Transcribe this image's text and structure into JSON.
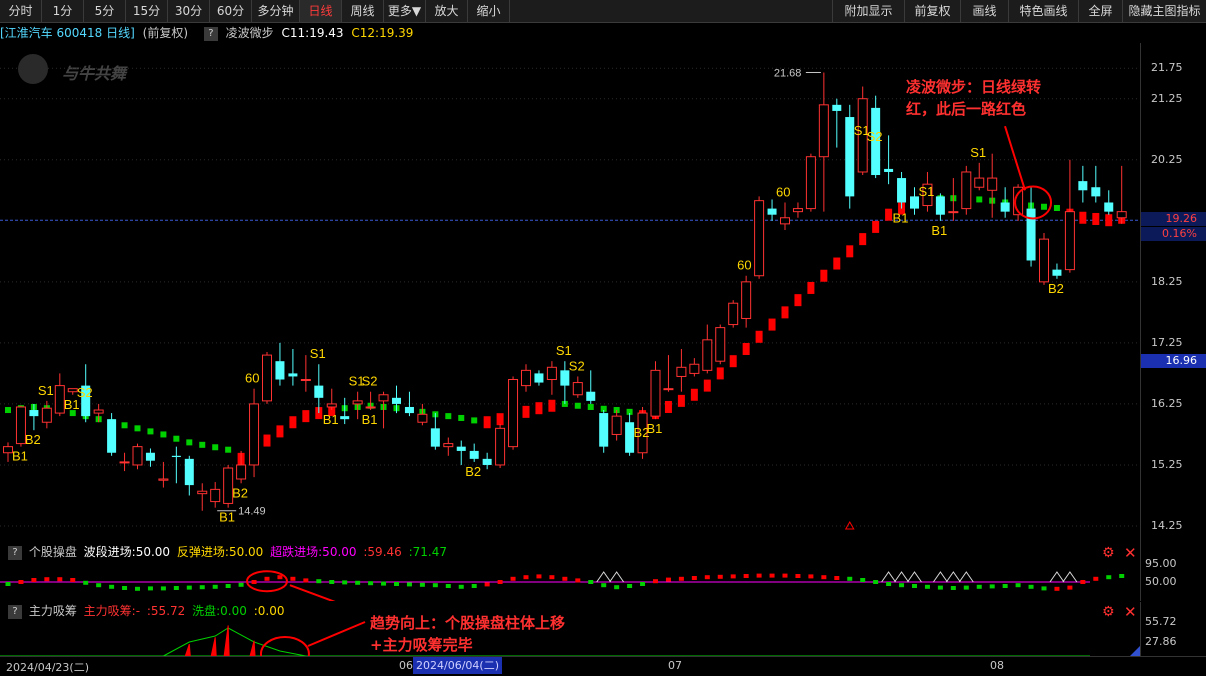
{
  "toolbar": {
    "left_buttons": [
      "分时",
      "1分",
      "5分",
      "15分",
      "30分",
      "60分",
      "多分钟",
      "日线",
      "周线",
      "更多▼",
      "放大",
      "缩小"
    ],
    "active": "日线",
    "right_buttons": [
      "附加显示",
      "前复权",
      "画线",
      "特色画线",
      "全屏",
      "隐藏主图指标"
    ]
  },
  "info": {
    "stock": "[江淮汽车 600418 日线]",
    "adjust": "(前复权)",
    "q": "?",
    "indicator": "凌波微步",
    "c11": "C11:19.43",
    "c12": "C12:19.39"
  },
  "watermark": "与牛共舞",
  "price_ticks": [
    "21.75",
    "21.25",
    "20.25",
    "19.26",
    "0.16%",
    "18.25",
    "17.25",
    "16.96",
    "16.25",
    "15.25",
    "14.25"
  ],
  "price_boxes": {
    "last": "19.26",
    "pct": "0.16%",
    "cursor": "16.96"
  },
  "annotations": {
    "top": "凌波微步：日线绿转红，此后一路红色",
    "bottom": "趋势向上：个股操盘柱体上移+主力吸筹完毕"
  },
  "labels": {
    "high": "21.68",
    "low": "14.49"
  },
  "panel1": {
    "q": "?",
    "name": "个股操盘",
    "wave": "波段进场:50.00",
    "rebound": "反弹进场:50.00",
    "oversold": "超跌进场:50.00",
    "v1": ":59.46",
    "v2": ":71.47",
    "ticks": [
      "95.00",
      "50.00"
    ]
  },
  "panel2": {
    "q": "?",
    "name": "主力吸筹",
    "main": "主力吸筹:-",
    "main_v": ":55.72",
    "wash": "洗盘:0.00",
    "v": ":0.00",
    "ticks": [
      "55.72",
      "27.86"
    ]
  },
  "gear_icon": "⚙",
  "close_icon": "✕",
  "dates": {
    "start": "2024/04/23(二)",
    "m06": "06",
    "highlight": "2024/06/04(二)",
    "m07": "07",
    "m08": "08"
  },
  "colors": {
    "up": "#ff3232",
    "down": "#54ffff",
    "green": "#00d000",
    "red": "#ff0000",
    "yellow": "#ffd700",
    "magenta": "#ff00ff"
  },
  "chart_data": {
    "type": "candlestick",
    "yrange": [
      14.25,
      21.95
    ],
    "candles": [
      [
        15.45,
        15.62,
        15.3,
        15.55
      ],
      [
        15.6,
        16.22,
        15.55,
        16.2
      ],
      [
        16.15,
        16.25,
        15.82,
        16.05
      ],
      [
        15.95,
        16.3,
        15.85,
        16.18
      ],
      [
        16.1,
        16.75,
        16.05,
        16.55
      ],
      [
        16.45,
        16.5,
        16.4,
        16.5
      ],
      [
        16.55,
        16.9,
        15.95,
        16.05
      ],
      [
        16.1,
        16.25,
        15.95,
        16.15
      ],
      [
        16.0,
        16.1,
        15.4,
        15.45
      ],
      [
        15.3,
        15.45,
        15.15,
        15.3
      ],
      [
        15.25,
        15.6,
        15.18,
        15.55
      ],
      [
        15.45,
        15.52,
        15.22,
        15.32
      ],
      [
        15.0,
        15.3,
        14.88,
        15.02
      ],
      [
        15.4,
        15.55,
        14.95,
        15.38
      ],
      [
        15.35,
        15.4,
        14.75,
        14.92
      ],
      [
        14.78,
        14.95,
        14.5,
        14.82
      ],
      [
        14.65,
        14.97,
        14.55,
        14.85
      ],
      [
        14.62,
        15.25,
        14.55,
        15.2
      ],
      [
        15.02,
        15.48,
        14.95,
        15.25
      ],
      [
        15.25,
        16.5,
        15.05,
        16.25
      ],
      [
        16.3,
        17.1,
        16.25,
        17.05
      ],
      [
        16.95,
        17.25,
        16.55,
        16.65
      ],
      [
        16.75,
        17.15,
        16.55,
        16.7
      ],
      [
        16.65,
        17.05,
        16.45,
        16.65
      ],
      [
        16.55,
        16.9,
        16.1,
        16.35
      ],
      [
        16.2,
        16.5,
        16.15,
        16.25
      ],
      [
        16.05,
        16.35,
        15.92,
        16.0
      ],
      [
        16.25,
        16.45,
        16.0,
        16.3
      ],
      [
        16.2,
        16.45,
        16.15,
        16.2
      ],
      [
        16.3,
        16.45,
        15.85,
        16.4
      ],
      [
        16.35,
        16.55,
        16.1,
        16.25
      ],
      [
        16.2,
        16.45,
        16.05,
        16.1
      ],
      [
        15.95,
        16.25,
        15.9,
        16.08
      ],
      [
        15.85,
        16.1,
        15.5,
        15.55
      ],
      [
        15.55,
        15.7,
        15.4,
        15.6
      ],
      [
        15.55,
        15.65,
        15.25,
        15.48
      ],
      [
        15.48,
        15.6,
        15.3,
        15.35
      ],
      [
        15.35,
        15.45,
        15.18,
        15.25
      ],
      [
        15.25,
        15.92,
        15.2,
        15.85
      ],
      [
        15.55,
        16.7,
        15.5,
        16.65
      ],
      [
        16.55,
        16.9,
        16.45,
        16.8
      ],
      [
        16.75,
        16.8,
        16.55,
        16.6
      ],
      [
        16.65,
        16.95,
        16.4,
        16.85
      ],
      [
        16.8,
        16.95,
        16.25,
        16.55
      ],
      [
        16.4,
        16.7,
        16.35,
        16.6
      ],
      [
        16.45,
        16.8,
        16.25,
        16.3
      ],
      [
        16.1,
        16.15,
        15.45,
        15.55
      ],
      [
        15.75,
        16.15,
        15.65,
        16.05
      ],
      [
        15.95,
        16.1,
        15.4,
        15.45
      ],
      [
        15.45,
        16.2,
        15.35,
        16.1
      ],
      [
        16.05,
        16.95,
        16.0,
        16.8
      ],
      [
        16.5,
        17.05,
        16.45,
        16.5
      ],
      [
        16.7,
        17.15,
        16.45,
        16.85
      ],
      [
        16.75,
        17.0,
        16.7,
        16.9
      ],
      [
        16.8,
        17.55,
        16.75,
        17.3
      ],
      [
        16.95,
        17.55,
        16.9,
        17.5
      ],
      [
        17.55,
        17.95,
        17.5,
        17.9
      ],
      [
        17.65,
        18.35,
        17.5,
        18.25
      ],
      [
        18.35,
        19.65,
        18.3,
        19.58
      ],
      [
        19.45,
        19.6,
        19.25,
        19.35
      ],
      [
        19.2,
        19.55,
        19.1,
        19.3
      ],
      [
        19.4,
        19.55,
        19.3,
        19.45
      ],
      [
        19.45,
        20.35,
        19.4,
        20.3
      ],
      [
        20.3,
        21.68,
        19.4,
        21.15
      ],
      [
        21.15,
        21.25,
        20.45,
        21.05
      ],
      [
        20.95,
        21.15,
        19.45,
        19.65
      ],
      [
        20.05,
        21.45,
        20.0,
        21.25
      ],
      [
        21.1,
        21.3,
        19.95,
        20.0
      ],
      [
        20.1,
        20.65,
        19.85,
        20.05
      ],
      [
        19.95,
        20.05,
        19.45,
        19.55
      ],
      [
        19.65,
        19.8,
        19.35,
        19.45
      ],
      [
        19.5,
        20.05,
        19.4,
        19.85
      ],
      [
        19.65,
        19.7,
        19.25,
        19.35
      ],
      [
        19.4,
        19.95,
        19.25,
        19.4
      ],
      [
        19.45,
        20.15,
        19.35,
        20.05
      ],
      [
        19.8,
        20.2,
        19.75,
        19.95
      ],
      [
        19.75,
        20.35,
        19.3,
        19.95
      ],
      [
        19.55,
        19.8,
        19.3,
        19.4
      ],
      [
        19.35,
        19.85,
        19.25,
        19.8
      ],
      [
        19.45,
        19.8,
        18.5,
        18.6
      ],
      [
        18.25,
        19.05,
        18.2,
        18.95
      ],
      [
        18.45,
        18.55,
        18.3,
        18.35
      ],
      [
        18.45,
        20.25,
        18.4,
        19.4
      ],
      [
        19.9,
        20.15,
        19.55,
        19.75
      ],
      [
        19.8,
        20.15,
        19.55,
        19.65
      ],
      [
        19.55,
        19.75,
        19.35,
        19.4
      ],
      [
        19.3,
        20.15,
        19.2,
        19.4
      ]
    ],
    "trail": [
      [
        "G",
        16.15
      ],
      [
        "G",
        16.18
      ],
      [
        "G",
        16.2
      ],
      [
        "G",
        16.18
      ],
      [
        "G",
        16.15
      ],
      [
        "G",
        16.1
      ],
      [
        "G",
        16.05
      ],
      [
        "G",
        16.0
      ],
      [
        "G",
        15.95
      ],
      [
        "G",
        15.9
      ],
      [
        "G",
        15.85
      ],
      [
        "G",
        15.8
      ],
      [
        "G",
        15.75
      ],
      [
        "G",
        15.68
      ],
      [
        "G",
        15.62
      ],
      [
        "G",
        15.58
      ],
      [
        "G",
        15.54
      ],
      [
        "G",
        15.5
      ],
      [
        "R",
        15.35
      ],
      [
        "R",
        15.45
      ],
      [
        "R",
        15.65
      ],
      [
        "R",
        15.8
      ],
      [
        "R",
        15.95
      ],
      [
        "R",
        16.05
      ],
      [
        "R",
        16.1
      ],
      [
        "R",
        16.15
      ],
      [
        "G",
        16.18
      ],
      [
        "G",
        16.2
      ],
      [
        "G",
        16.22
      ],
      [
        "G",
        16.2
      ],
      [
        "G",
        16.18
      ],
      [
        "G",
        16.15
      ],
      [
        "G",
        16.12
      ],
      [
        "G",
        16.08
      ],
      [
        "G",
        16.05
      ],
      [
        "G",
        16.02
      ],
      [
        "G",
        15.98
      ],
      [
        "R",
        15.95
      ],
      [
        "R",
        16.0
      ],
      [
        "R",
        16.05
      ],
      [
        "R",
        16.12
      ],
      [
        "R",
        16.18
      ],
      [
        "R",
        16.22
      ],
      [
        "G",
        16.25
      ],
      [
        "G",
        16.22
      ],
      [
        "G",
        16.2
      ],
      [
        "G",
        16.17
      ],
      [
        "G",
        16.15
      ],
      [
        "G",
        16.12
      ],
      [
        "R",
        16.05
      ],
      [
        "R",
        16.1
      ],
      [
        "R",
        16.2
      ],
      [
        "R",
        16.3
      ],
      [
        "R",
        16.4
      ],
      [
        "R",
        16.55
      ],
      [
        "R",
        16.75
      ],
      [
        "R",
        16.95
      ],
      [
        "R",
        17.15
      ],
      [
        "R",
        17.35
      ],
      [
        "R",
        17.55
      ],
      [
        "R",
        17.75
      ],
      [
        "R",
        17.95
      ],
      [
        "R",
        18.15
      ],
      [
        "R",
        18.35
      ],
      [
        "R",
        18.55
      ],
      [
        "R",
        18.75
      ],
      [
        "R",
        18.95
      ],
      [
        "R",
        19.15
      ],
      [
        "R",
        19.35
      ],
      [
        "R",
        19.45
      ],
      [
        "R",
        19.55
      ],
      [
        "G",
        19.6
      ],
      [
        "G",
        19.62
      ],
      [
        "G",
        19.62
      ],
      [
        "G",
        19.6
      ],
      [
        "G",
        19.6
      ],
      [
        "G",
        19.58
      ],
      [
        "G",
        19.55
      ],
      [
        "G",
        19.52
      ],
      [
        "G",
        19.5
      ],
      [
        "G",
        19.48
      ],
      [
        "G",
        19.46
      ],
      [
        "R",
        19.35
      ],
      [
        "R",
        19.3
      ],
      [
        "R",
        19.28
      ],
      [
        "R",
        19.26
      ],
      [
        "R",
        19.3
      ]
    ],
    "markers": [
      {
        "i": 3,
        "t": "S1",
        "p": "above"
      },
      {
        "i": 1,
        "t": "B1",
        "p": "below"
      },
      {
        "i": 2,
        "t": "B2",
        "p": "below"
      },
      {
        "i": 6,
        "t": "S2",
        "p": "mid"
      },
      {
        "i": 5,
        "t": "B1",
        "p": "below"
      },
      {
        "i": 19,
        "t": "60",
        "p": "above"
      },
      {
        "i": 17,
        "t": "B1",
        "p": "below"
      },
      {
        "i": 18,
        "t": "B2",
        "p": "below"
      },
      {
        "i": 24,
        "t": "S1",
        "p": "above"
      },
      {
        "i": 25,
        "t": "B1",
        "p": "below"
      },
      {
        "i": 27,
        "t": "S1",
        "p": "above"
      },
      {
        "i": 28,
        "t": "S2",
        "p": "above"
      },
      {
        "i": 28,
        "t": "B1",
        "p": "below"
      },
      {
        "i": 36,
        "t": "B2",
        "p": "below"
      },
      {
        "i": 43,
        "t": "S1",
        "p": "above"
      },
      {
        "i": 44,
        "t": "S2",
        "p": "above"
      },
      {
        "i": 50,
        "t": "B1",
        "p": "below"
      },
      {
        "i": 49,
        "t": "B2",
        "p": "mid"
      },
      {
        "i": 57,
        "t": "60",
        "p": "above"
      },
      {
        "i": 60,
        "t": "60",
        "p": "above"
      },
      {
        "i": 66,
        "t": "S1",
        "p": "mid"
      },
      {
        "i": 67,
        "t": "S2",
        "p": "mid"
      },
      {
        "i": 71,
        "t": "S1",
        "p": "mid"
      },
      {
        "i": 69,
        "t": "B1",
        "p": "below"
      },
      {
        "i": 72,
        "t": "B1",
        "p": "below"
      },
      {
        "i": 75,
        "t": "S1",
        "p": "above"
      },
      {
        "i": 81,
        "t": "B2",
        "p": "below"
      }
    ],
    "panel1_bars": [
      [
        45,
        "G"
      ],
      [
        50,
        "R"
      ],
      [
        55,
        "R"
      ],
      [
        57,
        "R"
      ],
      [
        57,
        "R"
      ],
      [
        55,
        "R"
      ],
      [
        48,
        "G"
      ],
      [
        42,
        "G"
      ],
      [
        38,
        "G"
      ],
      [
        35,
        "G"
      ],
      [
        33,
        "G"
      ],
      [
        34,
        "G"
      ],
      [
        34,
        "G"
      ],
      [
        35,
        "G"
      ],
      [
        36,
        "G"
      ],
      [
        37,
        "G"
      ],
      [
        38,
        "G"
      ],
      [
        40,
        "G"
      ],
      [
        43,
        "G"
      ],
      [
        50,
        "R"
      ],
      [
        58,
        "R"
      ],
      [
        62,
        "R"
      ],
      [
        58,
        "R"
      ],
      [
        54,
        "R"
      ],
      [
        52,
        "G"
      ],
      [
        50,
        "G"
      ],
      [
        49,
        "G"
      ],
      [
        48,
        "G"
      ],
      [
        47,
        "G"
      ],
      [
        46,
        "G"
      ],
      [
        45,
        "G"
      ],
      [
        44,
        "G"
      ],
      [
        43,
        "G"
      ],
      [
        42,
        "G"
      ],
      [
        40,
        "G"
      ],
      [
        38,
        "G"
      ],
      [
        40,
        "G"
      ],
      [
        44,
        "R"
      ],
      [
        50,
        "R"
      ],
      [
        58,
        "R"
      ],
      [
        62,
        "R"
      ],
      [
        64,
        "R"
      ],
      [
        62,
        "R"
      ],
      [
        58,
        "R"
      ],
      [
        54,
        "R"
      ],
      [
        50,
        "G"
      ],
      [
        42,
        "G"
      ],
      [
        37,
        "G"
      ],
      [
        40,
        "G"
      ],
      [
        45,
        "G"
      ],
      [
        52,
        "R"
      ],
      [
        56,
        "R"
      ],
      [
        58,
        "R"
      ],
      [
        60,
        "R"
      ],
      [
        62,
        "R"
      ],
      [
        63,
        "R"
      ],
      [
        64,
        "R"
      ],
      [
        65,
        "R"
      ],
      [
        66,
        "R"
      ],
      [
        66,
        "R"
      ],
      [
        66,
        "R"
      ],
      [
        65,
        "R"
      ],
      [
        64,
        "R"
      ],
      [
        62,
        "R"
      ],
      [
        60,
        "R"
      ],
      [
        58,
        "G"
      ],
      [
        55,
        "G"
      ],
      [
        50,
        "G"
      ],
      [
        45,
        "G"
      ],
      [
        42,
        "G"
      ],
      [
        40,
        "G"
      ],
      [
        38,
        "G"
      ],
      [
        36,
        "G"
      ],
      [
        35,
        "G"
      ],
      [
        36,
        "G"
      ],
      [
        38,
        "G"
      ],
      [
        39,
        "G"
      ],
      [
        40,
        "G"
      ],
      [
        42,
        "G"
      ],
      [
        38,
        "G"
      ],
      [
        34,
        "G"
      ],
      [
        33,
        "R"
      ],
      [
        36,
        "R"
      ],
      [
        50,
        "R"
      ],
      [
        58,
        "R"
      ],
      [
        62,
        "G"
      ],
      [
        65,
        "G"
      ]
    ],
    "panel2_spikes": [
      [
        14,
        0.35
      ],
      [
        16,
        0.55
      ],
      [
        17,
        0.9
      ],
      [
        19,
        0.45
      ]
    ],
    "panel1_tri": [
      46,
      47,
      68,
      69,
      70,
      72,
      73,
      74,
      81,
      82
    ]
  }
}
